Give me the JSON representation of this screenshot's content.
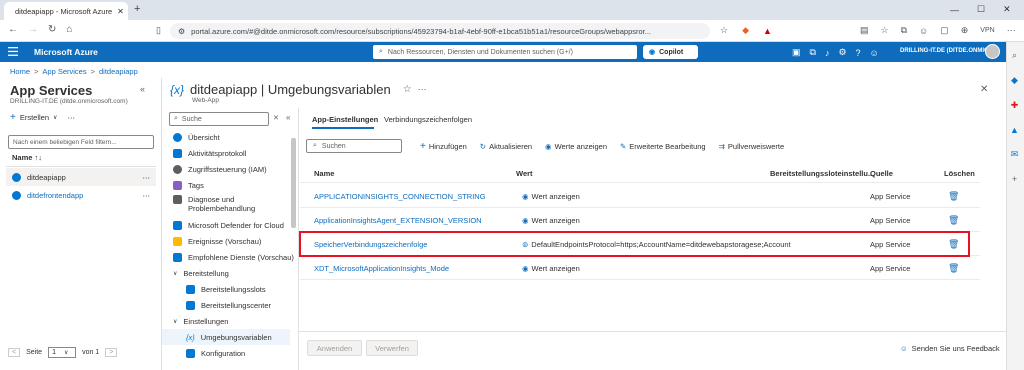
{
  "browser": {
    "tab_title": "ditdeapiapp - Microsoft Azure",
    "new_tab": "+",
    "url": "portal.azure.com/#@ditde.onmicrosoft.com/resource/subscriptions/45923794-b1af-4ebf-90ff-e1bca51b51a1/resourceGroups/webappsror...",
    "vpn_label": "VPN"
  },
  "portal": {
    "brand": "Microsoft Azure",
    "search_placeholder": "Nach Ressourcen, Diensten und Dokumenten suchen (G+/)",
    "copilot_label": "Copilot",
    "account": "DRILLING-IT.DE (DITDE.ONMICR..."
  },
  "breadcrumb": {
    "items": [
      "Home",
      "App Services",
      "ditdeapiapp"
    ],
    "separator": ">"
  },
  "left_panel": {
    "title": "App Services",
    "subtitle": "DRILLING-IT.DE (ditde.onmicrosoft.com)",
    "create_label": "Erstellen",
    "filter_placeholder": "Nach einem beliebigen Feld filtern...",
    "column_header": "Name ↑↓",
    "apps": [
      "ditdeapiapp",
      "ditdefrontendapp"
    ],
    "pager": {
      "page_label": "Seite",
      "page_value": "1",
      "of_label": "von 1"
    }
  },
  "resource": {
    "title": "ditdeapiapp | Umgebungsvariablen",
    "type": "Web-App",
    "icon_text": "{x}"
  },
  "menu": {
    "search_placeholder": "Suche",
    "items": [
      {
        "label": "Übersicht",
        "color": "#0078d4"
      },
      {
        "label": "Aktivitätsprotokoll",
        "color": "#0078d4"
      },
      {
        "label": "Zugriffssteuerung (IAM)",
        "color": "#605e5c"
      },
      {
        "label": "Tags",
        "color": "#8661c5"
      },
      {
        "label": "Diagnose und Problembehandlung",
        "color": "#605e5c"
      },
      {
        "label": "Microsoft Defender for Cloud",
        "color": "#0078d4"
      },
      {
        "label": "Ereignisse (Vorschau)",
        "color": "#ffb900"
      },
      {
        "label": "Empfohlene Dienste (Vorschau)",
        "color": "#0078d4"
      },
      {
        "label": "Bereitstellung",
        "color": "#605e5c"
      },
      {
        "label": "Bereitstellungsslots",
        "color": "#0078d4"
      },
      {
        "label": "Bereitstellungscenter",
        "color": "#0078d4"
      },
      {
        "label": "Einstellungen",
        "color": "#605e5c"
      },
      {
        "label": "Umgebungsvariablen",
        "color": "#0078d4"
      },
      {
        "label": "Konfiguration",
        "color": "#0078d4"
      }
    ]
  },
  "tabs": [
    "App-Einstellungen",
    "Verbindungszeichenfolgen"
  ],
  "toolbar": {
    "search_placeholder": "Suchen",
    "add": "Hinzufügen",
    "refresh": "Aktualisieren",
    "show_values": "Werte anzeigen",
    "advanced_edit": "Erweiterte Bearbeitung",
    "pull_refs": "Pullverweiswerte"
  },
  "table": {
    "headers": [
      "Name",
      "Wert",
      "Bereitstellungssloteinstellu...",
      "Quelle",
      "Löschen"
    ],
    "rows": [
      {
        "name": "APPLICATIONINSIGHTS_CONNECTION_STRING",
        "value": "Wert anzeigen",
        "source": "App Service"
      },
      {
        "name": "ApplicationInsightsAgent_EXTENSION_VERSION",
        "value": "Wert anzeigen",
        "source": "App Service"
      },
      {
        "name": "SpeicherVerbindungszeichenfolge",
        "value": "DefaultEndpointsProtocol=https;AccountName=ditdewebapstoragese;Account",
        "source": "App Service"
      },
      {
        "name": "XDT_MicrosoftApplicationInsights_Mode",
        "value": "Wert anzeigen",
        "source": "App Service"
      }
    ]
  },
  "footer": {
    "apply": "Anwenden",
    "discard": "Verwerfen",
    "feedback": "Senden Sie uns Feedback"
  },
  "colors": {
    "accent": "#0f6cbd",
    "highlight": "#e81123"
  }
}
